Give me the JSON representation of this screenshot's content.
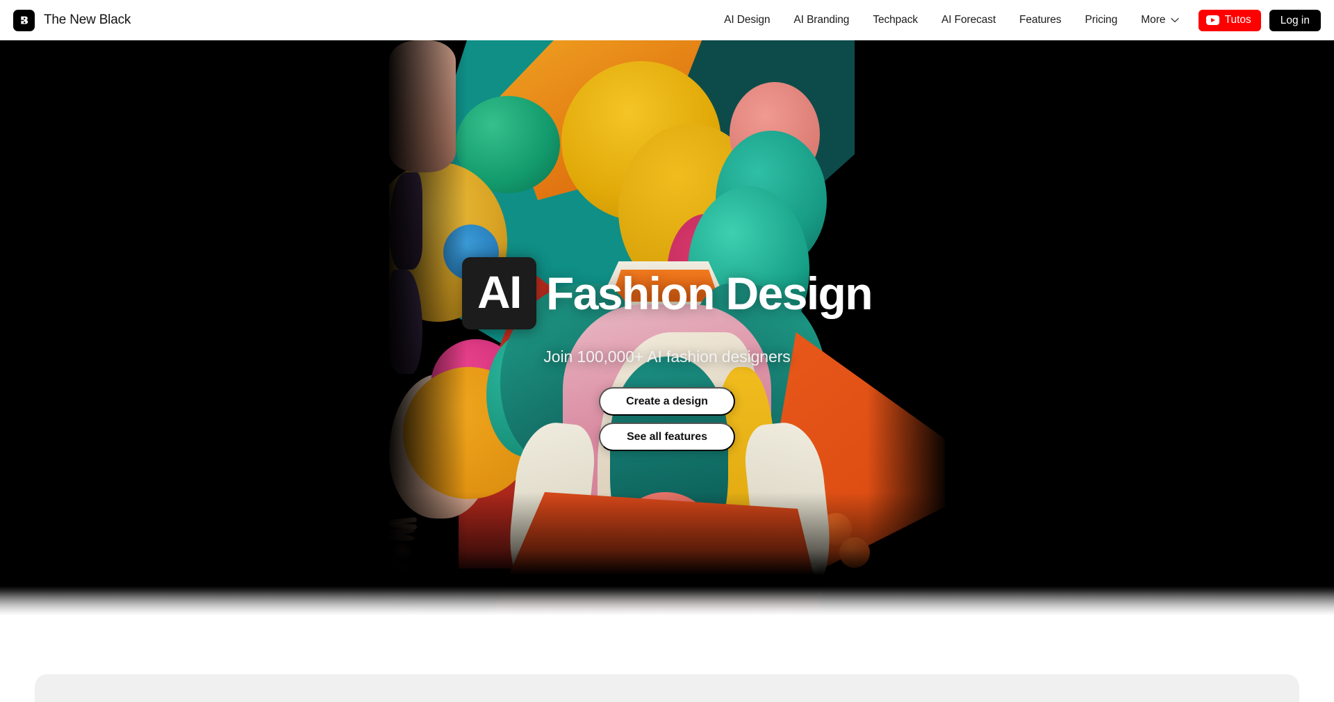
{
  "header": {
    "brand": {
      "name": "The New Black",
      "logo_icon": "the-new-black-logo-icon"
    },
    "nav_links": [
      {
        "label": "AI Design"
      },
      {
        "label": "AI Branding"
      },
      {
        "label": "Techpack"
      },
      {
        "label": "AI Forecast"
      },
      {
        "label": "Features"
      },
      {
        "label": "Pricing"
      }
    ],
    "more": {
      "label": "More",
      "icon": "chevron-down-icon"
    },
    "tutos_button": {
      "label": "Tutos",
      "icon": "youtube-play-icon",
      "color": "#ff0000"
    },
    "login_button": {
      "label": "Log in",
      "color": "#000000"
    }
  },
  "hero": {
    "headline_badge": "AI",
    "headline_rest": "Fashion Design",
    "subheadline": "Join 100,000+ AI fashion designers",
    "primary_cta": "Create a design",
    "secondary_cta": "See all features",
    "background": "ai-generated-fashion-model-colorful-abstract-shapes",
    "background_color": "#000000"
  }
}
